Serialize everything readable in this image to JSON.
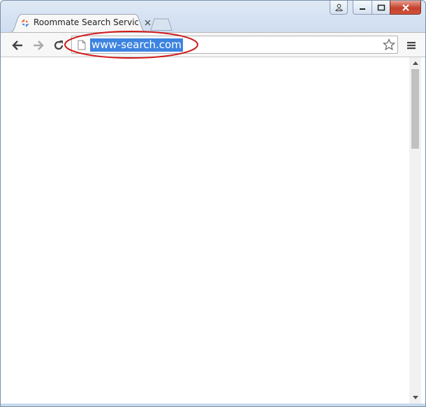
{
  "tab": {
    "title": "Roommate Search Service"
  },
  "address_bar": {
    "url": "www-search.com"
  },
  "icons": {
    "back": "back-arrow-icon",
    "forward": "forward-arrow-icon",
    "reload": "reload-icon",
    "page": "page-icon",
    "bookmark": "star-icon",
    "menu": "hamburger-menu-icon",
    "user": "user-icon",
    "minimize": "minimize-icon",
    "maximize": "maximize-icon",
    "close": "close-icon"
  },
  "colors": {
    "selection": "#3d83e0",
    "annotation": "#d01818"
  }
}
